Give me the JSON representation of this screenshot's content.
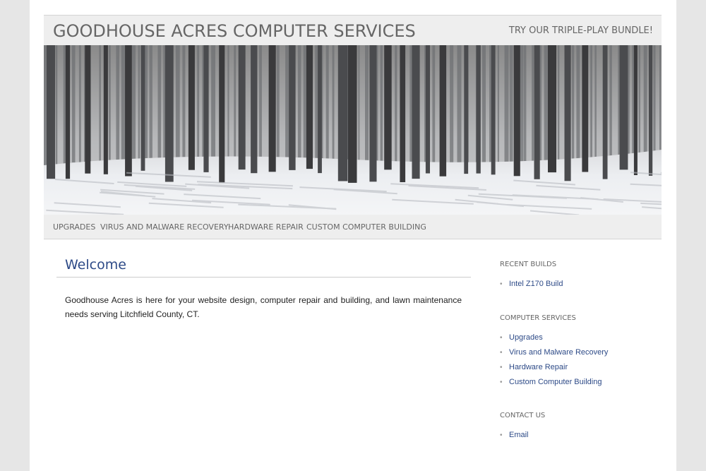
{
  "site": {
    "title": "GOODHOUSE ACRES COMPUTER SERVICES",
    "tagline": "TRY OUR TRIPLE-PLAY BUNDLE!"
  },
  "banner": {
    "description_icon": "winter-forest-image"
  },
  "nav": {
    "items": [
      {
        "label": "UPGRADES"
      },
      {
        "label": "VIRUS AND MALWARE RECOVERY"
      },
      {
        "label": "HARDWARE REPAIR"
      },
      {
        "label": "CUSTOM COMPUTER BUILDING"
      }
    ]
  },
  "main": {
    "title": "Welcome",
    "body": "Goodhouse Acres is here for your website design, computer repair and building, and lawn maintenance needs serving Litchfield County, CT."
  },
  "sidebar": {
    "recent_builds": {
      "title": "RECENT BUILDS",
      "items": [
        {
          "label": "Intel Z170 Build"
        }
      ]
    },
    "computer_services": {
      "title": "COMPUTER SERVICES",
      "items": [
        {
          "label": "Upgrades"
        },
        {
          "label": "Virus and Malware Recovery"
        },
        {
          "label": "Hardware Repair"
        },
        {
          "label": "Custom Computer Building"
        }
      ]
    },
    "contact_us": {
      "title": "CONTACT US",
      "items": [
        {
          "label": "Email"
        }
      ]
    }
  },
  "colors": {
    "background": "#e6e6e6",
    "header_band": "#eeeeee",
    "link": "#2d4a87",
    "muted_text": "#666666"
  }
}
